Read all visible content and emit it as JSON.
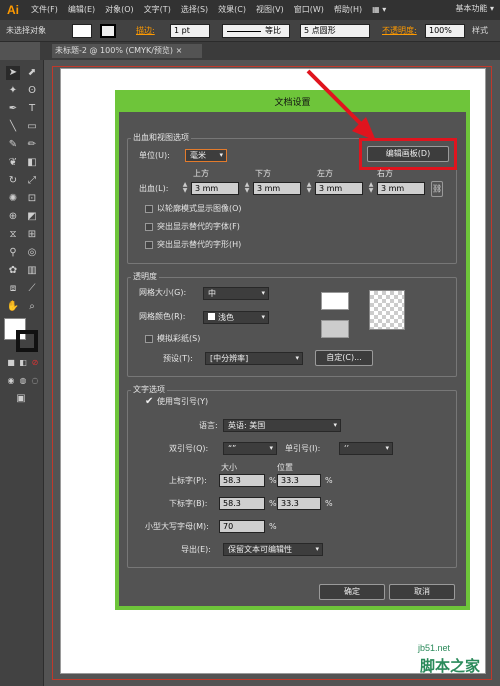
{
  "app": {
    "logo": "Ai",
    "workspace": "基本功能 ▾"
  },
  "menu": [
    "文件(F)",
    "编辑(E)",
    "对象(O)",
    "文字(T)",
    "选择(S)",
    "效果(C)",
    "视图(V)",
    "窗口(W)",
    "帮助(H)"
  ],
  "control": {
    "no_selection": "未选择对象",
    "stroke_label": "描边:",
    "stroke_value": "1 pt",
    "line_style": "等比",
    "brush": "5 点圆形",
    "opacity_label": "不透明度:",
    "opacity_value": "100%",
    "style_label": "样式"
  },
  "doc_tab": "未标题-2 @ 100% (CMYK/预览)",
  "dialog": {
    "title": "文档设置",
    "bleed": {
      "group_title": "出血和视图选项",
      "unit_label": "单位(U):",
      "unit_value": "毫米",
      "edit_artboards": "编辑画板(D)",
      "bleed_label": "出血(L):",
      "top_label": "上方",
      "bottom_label": "下方",
      "left_label": "左方",
      "right_label": "右方",
      "top": "3 mm",
      "bottom": "3 mm",
      "left": "3 mm",
      "right": "3 mm",
      "option1": "以轮廓模式显示图像(O)",
      "option2": "突出显示替代的字体(F)",
      "option3": "突出显示替代的字形(H)"
    },
    "transparency": {
      "group_title": "透明度",
      "grid_size_label": "网格大小(G):",
      "grid_size_value": "中",
      "grid_color_label": "网格颜色(R):",
      "grid_color_value": "浅色",
      "simulate_paper": "模拟彩纸(S)",
      "preset_label": "预设(T):",
      "preset_value": "[中分辨率]",
      "custom_button": "自定(C)..."
    },
    "type": {
      "group_title": "文字选项",
      "use_quotes": "使用弯引号(Y)",
      "language_label": "语言:",
      "language_value": "英语: 美国",
      "double_label": "双引号(Q):",
      "double_value": "“”",
      "single_label": "单引号(I):",
      "single_value": "‘’",
      "size_header": "大小",
      "position_header": "位置",
      "superscript_label": "上标字(P):",
      "superscript_size": "58.3",
      "superscript_pos": "33.3",
      "subscript_label": "下标字(B):",
      "subscript_size": "58.3",
      "subscript_pos": "33.3",
      "smallcaps_label": "小型大写字母(M):",
      "smallcaps_value": "70",
      "percent": "%",
      "export_label": "导出(E):",
      "export_value": "保留文本可编辑性"
    },
    "ok": "确定",
    "cancel": "取消"
  },
  "watermark": {
    "line1": "jb51.net",
    "line2": "脚本之家"
  },
  "colors": {
    "accent_green": "#6ec53a",
    "highlight_red": "#e0141e"
  }
}
